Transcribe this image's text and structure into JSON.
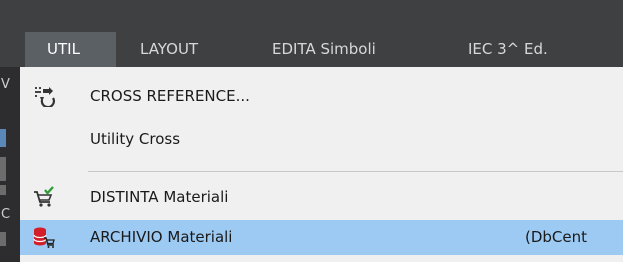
{
  "menubar": {
    "items": [
      {
        "label": "UTIL",
        "active": true
      },
      {
        "label": "LAYOUT"
      },
      {
        "label": "EDITA Simboli"
      },
      {
        "label": "IEC 3^ Ed."
      }
    ]
  },
  "left_strip": {
    "glyphs": [
      "V",
      "C"
    ]
  },
  "dropdown": {
    "items": [
      {
        "label": "CROSS REFERENCE...",
        "icon": "cross-reference-icon"
      },
      {
        "label": "Utility Cross"
      },
      {
        "label": "DISTINTA Materiali",
        "icon": "cart-check-icon"
      },
      {
        "label": "ARCHIVIO Materiali",
        "shortcut": "(DbCent",
        "icon": "database-cart-icon",
        "highlighted": true
      }
    ]
  },
  "colors": {
    "menubar_bg": "#3f4042",
    "active_tab_bg": "#5b6065",
    "dropdown_bg": "#f0f0f0",
    "highlight_bg": "#9dcaf3",
    "accent_red": "#d21f2a",
    "accent_green": "#2e9d3a"
  }
}
